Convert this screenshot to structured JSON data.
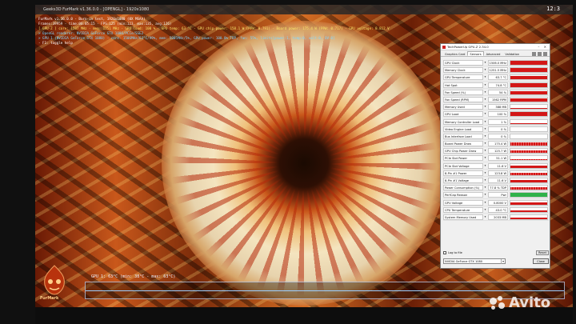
{
  "titlebar": {
    "title": "Geeks3D FurMark v1.36.0.0 - [OPENGL] - 1920x1080",
    "controls": "–  ☐  ✕"
  },
  "clock": "12:3",
  "osd": {
    "line1": "FurMark v1.36.0.0 - Burn-in test, 1920x1080 (0X MSAA)",
    "line2": "Frames:39959 - time:00:05:15 - FPS:125 (min:123, max:135, avg:126)",
    "line3": "[ GPU-Z ] core: 1507 MHz - mem: 1251 MHz - GPU load: 100 % - GPU temp: 63 °C - GPU chip power: 158.1 W (PPW: 0.791) - Board power: 175.4 W (PPW: 0.717) - GPU voltage: 0.812 V",
    "line4": "> OpenGL renderer: NVIDIA GeForce GTX 1080/PCIe/SSE2",
    "line5": "> GPU 1 (NVIDIA GeForce GTX 1080) - core: 1506MHz/63°C/99%, mem: 5005MHz/5%, GPU power: 100.0% TDP, fan: 55%, limits[power:1, temp:0, volt:0, OV:0]",
    "line6": "- F1: toggle help"
  },
  "bottom_graph": {
    "label": "GPU 1: 63°C (min: 38°C - max: 63°C)"
  },
  "logo": {
    "text": "FurMark"
  },
  "gpuz": {
    "title": "TechPowerUp GPU-Z 2.34.0",
    "window_controls": "–  ✕",
    "tabs": [
      "Graphics Card",
      "Sensors",
      "Advanced",
      "Validation"
    ],
    "active_tab": "Sensors",
    "sensors": [
      {
        "name": "GPU Clock",
        "value": "1506.0 MHz",
        "fill": 0.95
      },
      {
        "name": "Memory Clock",
        "value": "1251.5 MHz",
        "fill": 0.95
      },
      {
        "name": "GPU Temperature",
        "value": "63.7 °C",
        "fill": 0.85
      },
      {
        "name": "Hot Spot",
        "value": "74.8 °C",
        "fill": 0.85
      },
      {
        "name": "Fan Speed (%)",
        "value": "54 %",
        "fill": 0.7
      },
      {
        "name": "Fan Speed (RPM)",
        "value": "1562 RPM",
        "fill": 0.7
      },
      {
        "name": "Memory Used",
        "value": "388 MB",
        "fill": 0.15
      },
      {
        "name": "GPU Load",
        "value": "100 %",
        "fill": 1.0
      },
      {
        "name": "Memory Controller Load",
        "value": "1 %",
        "fill": 0.05
      },
      {
        "name": "Video Engine Load",
        "value": "0 %",
        "fill": 0.0
      },
      {
        "name": "Bus Interface Load",
        "value": "0 %",
        "fill": 0.0
      },
      {
        "name": "Board Power Draw",
        "value": "175.4 W",
        "fill": 0.75,
        "noisy": true
      },
      {
        "name": "GPU Chip Power Draw",
        "value": "125.7 W",
        "fill": 0.7,
        "noisy": true
      },
      {
        "name": "PCIe Slot Power",
        "value": "51.1 W",
        "fill": 0.35,
        "noisy": true
      },
      {
        "name": "PCIe Slot Voltage",
        "value": "11.6 V",
        "fill": 0.6
      },
      {
        "name": "8-Pin #1 Power",
        "value": "123.8 W",
        "fill": 0.65,
        "noisy": true
      },
      {
        "name": "8-Pin #1 Voltage",
        "value": "11.6 V",
        "fill": 0.6
      },
      {
        "name": "Power Consumption (%)",
        "value": "77.8 % TDP",
        "fill": 0.7,
        "noisy": true
      },
      {
        "name": "PerfCap Reason",
        "value": "Pwr",
        "fill": 1.0,
        "perfcap": true
      },
      {
        "name": "GPU Voltage",
        "value": "0.8000 V",
        "fill": 0.45
      },
      {
        "name": "CPU Temperature",
        "value": "43.0 °C",
        "fill": 0.45
      },
      {
        "name": "System Memory Used",
        "value": "2033 MB",
        "fill": 0.4
      }
    ],
    "log_label": "Log to file",
    "reset_label": "Reset",
    "gpu_select": "NVIDIA GeForce GTX 1080",
    "close_label": "Close"
  },
  "watermark": {
    "text": "Avito"
  },
  "colors": {
    "sensor_bar": "#d31717",
    "perfcap": "#2fb24a",
    "window_bg": "#f0f0f0"
  }
}
